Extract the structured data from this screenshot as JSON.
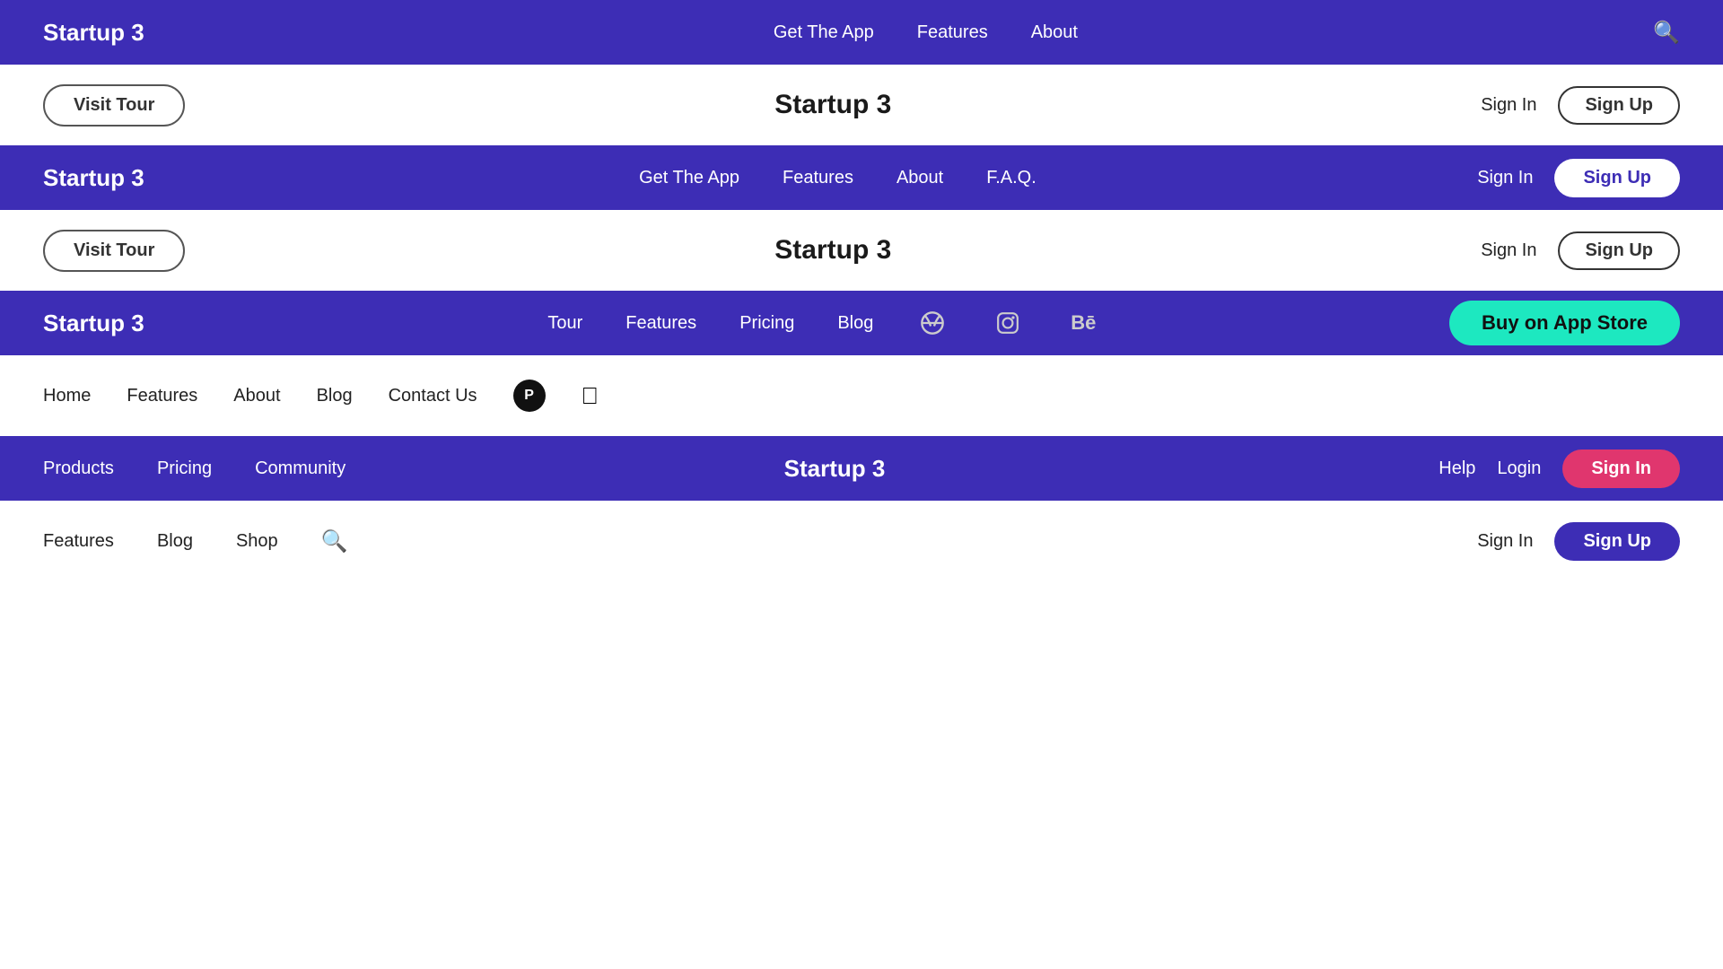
{
  "navbars": [
    {
      "id": "nav1",
      "theme": "dark",
      "brand": "Startup 3",
      "links": [
        "Get The App",
        "Features",
        "About"
      ],
      "hasSearch": true,
      "rightItems": []
    },
    {
      "id": "nav2",
      "theme": "light",
      "brand": "",
      "links": [],
      "hasSearch": false,
      "rightItems": [
        "Sign In",
        "Sign Up"
      ]
    },
    {
      "id": "nav3",
      "theme": "dark",
      "brand": "Startup 3",
      "links": [
        "Get The App",
        "Features",
        "About",
        "F.A.Q."
      ],
      "hasSearch": false,
      "rightItems": [
        "Sign In",
        "Sign Up"
      ]
    },
    {
      "id": "nav4",
      "theme": "light",
      "brand": "",
      "links": [],
      "hasSearch": false,
      "rightItems": [
        "Sign In",
        "Sign Up"
      ]
    },
    {
      "id": "nav5",
      "theme": "dark",
      "brand": "Startup 3",
      "links": [
        "Tour",
        "Features",
        "Pricing",
        "Blog"
      ],
      "hasSocial": true,
      "rightItems": [],
      "hasBuyBtn": true
    },
    {
      "id": "nav6",
      "theme": "light",
      "brand": "",
      "links": [
        "Home",
        "Features",
        "About",
        "Blog",
        "Contact Us"
      ],
      "hasSocialP": true,
      "hasSocialApple": true,
      "rightItems": []
    },
    {
      "id": "nav7",
      "theme": "dark",
      "brand": "Startup 3",
      "links": [
        "Products",
        "Pricing",
        "Community"
      ],
      "hasSearch": false,
      "rightItems": [
        "Help",
        "Login"
      ],
      "hasSignInPink": true
    },
    {
      "id": "nav8",
      "theme": "light",
      "brand": "",
      "links": [
        "Features",
        "Blog",
        "Shop"
      ],
      "hasSearch": true,
      "rightItems": [
        "Sign In"
      ],
      "hasSignUpPurple": true
    }
  ],
  "content_strips": [
    {
      "id": "cs1",
      "theme": "light",
      "title": "Startup 3",
      "leftBtn": "Visit Tour"
    },
    {
      "id": "cs2",
      "theme": "light",
      "title": "Startup 3",
      "leftBtn": "Visit Tour"
    },
    {
      "id": "cs3",
      "theme": "dark",
      "title": "Startup 3",
      "leftBtn": null
    },
    {
      "id": "cs4",
      "theme": "dark",
      "title": "Startup 3",
      "leftBtn": null
    }
  ],
  "labels": {
    "brand": "Startup 3",
    "get_the_app": "Get The App",
    "features": "Features",
    "about": "About",
    "faq": "F.A.Q.",
    "tour": "Tour",
    "pricing": "Pricing",
    "blog": "Blog",
    "home": "Home",
    "contact_us": "Contact Us",
    "shop": "Shop",
    "products": "Products",
    "community": "Community",
    "sign_in": "Sign In",
    "sign_up": "Sign Up",
    "login": "Login",
    "help": "Help",
    "visit_tour": "Visit Tour",
    "buy_app_store": "Buy on App Store"
  }
}
